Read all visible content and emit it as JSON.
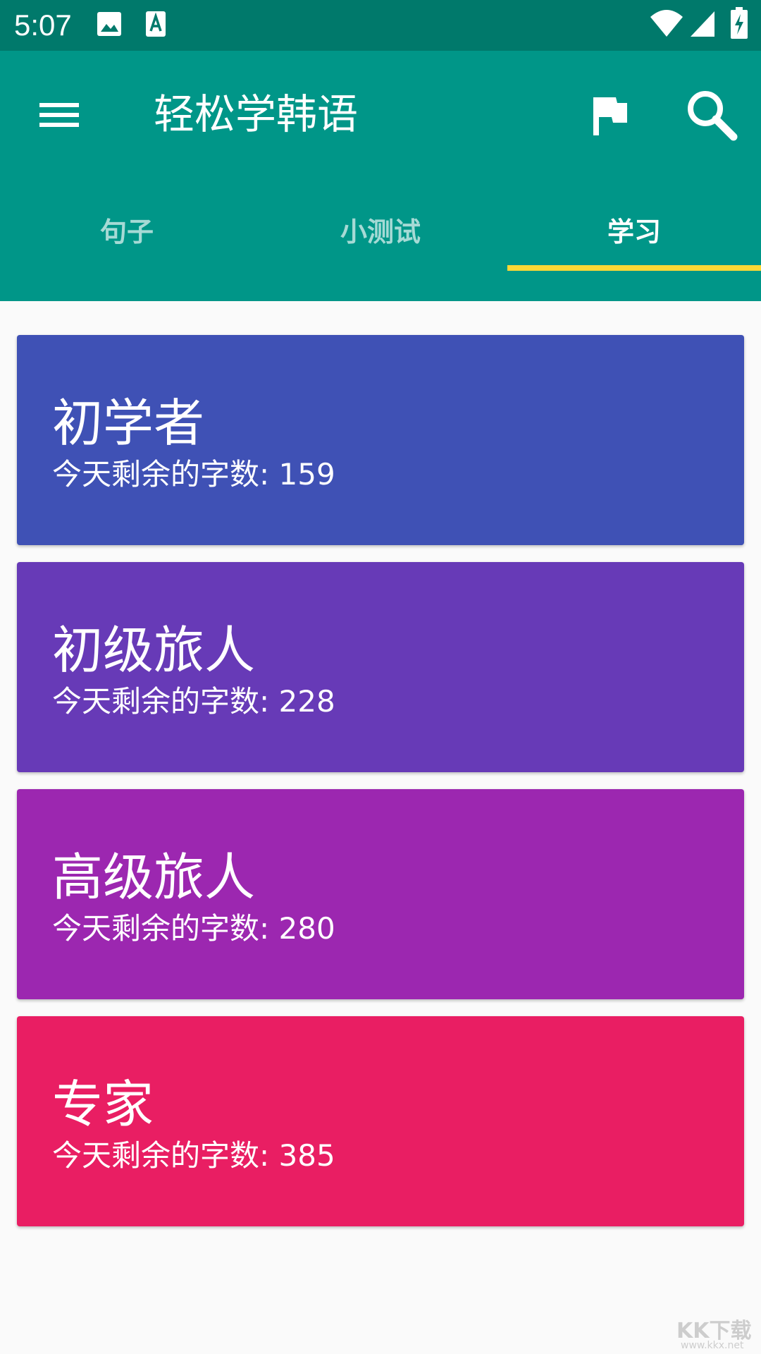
{
  "status_bar": {
    "time": "5:07",
    "icons": [
      "image-icon",
      "text-a-icon",
      "wifi-icon",
      "signal-icon",
      "battery-charging-icon"
    ]
  },
  "app_bar": {
    "title": "轻松学韩语",
    "menu_icon": "menu-icon",
    "flag_icon": "flag-icon",
    "search_icon": "search-icon",
    "background": "#009688",
    "status_bar_color": "#00796b"
  },
  "tabs": [
    {
      "label": "句子",
      "active": false
    },
    {
      "label": "小测试",
      "active": false
    },
    {
      "label": "学习",
      "active": true
    }
  ],
  "tab_indicator_color": "#fdd835",
  "levels": [
    {
      "title": "初学者",
      "subtitle": "今天剩余的字数: 159",
      "color": "#3f51b5"
    },
    {
      "title": "初级旅人",
      "subtitle": "今天剩余的字数: 228",
      "color": "#673ab7"
    },
    {
      "title": "高级旅人",
      "subtitle": "今天剩余的字数: 280",
      "color": "#9c27b0"
    },
    {
      "title": "专家",
      "subtitle": "今天剩余的字数: 385",
      "color": "#e91e63"
    }
  ],
  "watermark": {
    "main": "KK下载",
    "sub": "www.kkx.net"
  }
}
